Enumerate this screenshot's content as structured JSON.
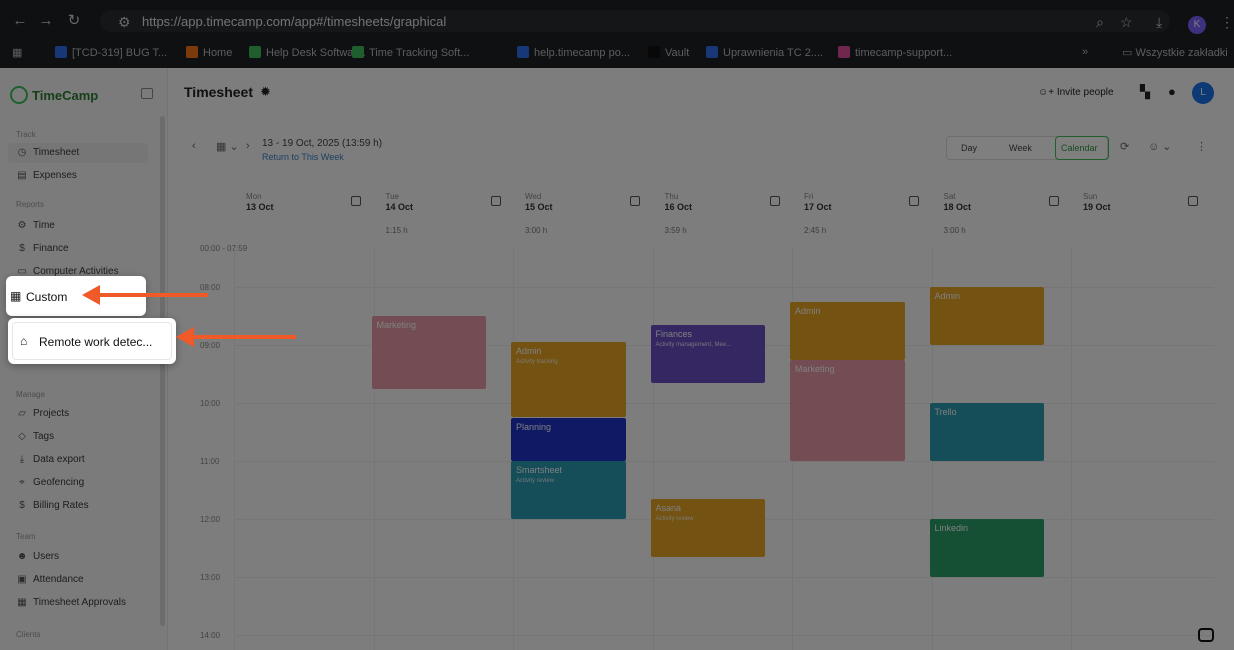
{
  "browser": {
    "url": "https://app.timecamp.com/app#/timesheets/graphical",
    "profile_initial": "K",
    "bookmarks": [
      {
        "label": "[TCD-319] BUG T...",
        "color": "#2f6fed"
      },
      {
        "label": "Home",
        "color": "#f97316"
      },
      {
        "label": "Help Desk Softwar...",
        "color": "#3fbf5a"
      },
      {
        "label": "Time Tracking Soft...",
        "color": "#3fbf5a"
      },
      {
        "label": "help.timecamp po...",
        "color": "#2f6fed"
      },
      {
        "label": "Vault",
        "color": "#111111"
      },
      {
        "label": "Uprawnienia TC 2....",
        "color": "#2f6fed"
      },
      {
        "label": "timecamp-support...",
        "color": "#e04e9a"
      }
    ],
    "more_label": "»",
    "all_bookmarks": "Wszystkie zakładki"
  },
  "app": {
    "logo": "TimeCamp",
    "page_title": "Timesheet",
    "invite_label": "Invite people",
    "avatar_initial": "L"
  },
  "sidebar": {
    "track_label": "Track",
    "reports_label": "Reports",
    "manage_label": "Manage",
    "team_label": "Team",
    "clients_label": "Clients",
    "items": {
      "timesheet": "Timesheet",
      "expenses": "Expenses",
      "time": "Time",
      "finance": "Finance",
      "computer_activities": "Computer Activities",
      "projects": "Projects",
      "tags": "Tags",
      "data_export": "Data export",
      "geofencing": "Geofencing",
      "billing_rates": "Billing Rates",
      "users": "Users",
      "attendance": "Attendance",
      "timesheet_approvals": "Timesheet Approvals"
    }
  },
  "toolbar": {
    "range": "13 - 19 Oct, 2025 (13:59 h)",
    "return_link": "Return to This Week",
    "views": [
      "Day",
      "Week",
      "Calendar"
    ],
    "active_view": "Calendar"
  },
  "calendar": {
    "days": [
      {
        "name": "Mon",
        "date": "13 Oct",
        "total": ""
      },
      {
        "name": "Tue",
        "date": "14 Oct",
        "total": "1:15 h"
      },
      {
        "name": "Wed",
        "date": "15 Oct",
        "total": "3:00 h"
      },
      {
        "name": "Thu",
        "date": "16 Oct",
        "total": "3:59 h"
      },
      {
        "name": "Fri",
        "date": "17 Oct",
        "total": "2:45 h"
      },
      {
        "name": "Sat",
        "date": "18 Oct",
        "total": "3:00 h"
      },
      {
        "name": "Sun",
        "date": "19 Oct",
        "total": ""
      }
    ],
    "allday_label": "00:00 - 07:59",
    "hours": [
      "08:00",
      "09:00",
      "10:00",
      "11:00",
      "12:00",
      "13:00",
      "14:00"
    ],
    "events": [
      {
        "day": 1,
        "start": 8.5,
        "end": 9.75,
        "title": "Marketing",
        "sub": "",
        "color": "#e89aa8"
      },
      {
        "day": 2,
        "start": 8.95,
        "end": 10.25,
        "title": "Admin",
        "sub": "Activity tracking",
        "color": "#e6a425"
      },
      {
        "day": 2,
        "start": 10.25,
        "end": 11.0,
        "title": "Planning",
        "sub": "",
        "color": "#1e33c8"
      },
      {
        "day": 2,
        "start": 11.0,
        "end": 12.0,
        "title": "Smartsheet",
        "sub": "Activity review",
        "color": "#2a9ab0"
      },
      {
        "day": 3,
        "start": 8.65,
        "end": 9.65,
        "title": "Finances",
        "sub": "Activity management, Mee...",
        "color": "#6a4fc4"
      },
      {
        "day": 3,
        "start": 11.65,
        "end": 12.65,
        "title": "Asana",
        "sub": "Activity review",
        "color": "#e6a425"
      },
      {
        "day": 4,
        "start": 8.25,
        "end": 9.25,
        "title": "Admin",
        "sub": "",
        "color": "#e6a425"
      },
      {
        "day": 4,
        "start": 9.25,
        "end": 11.0,
        "title": "Marketing",
        "sub": "",
        "color": "#e89aa8"
      },
      {
        "day": 5,
        "start": 8.0,
        "end": 9.0,
        "title": "Admin",
        "sub": "",
        "color": "#e6a425"
      },
      {
        "day": 5,
        "start": 10.0,
        "end": 11.0,
        "title": "Trello",
        "sub": "",
        "color": "#2a9ab0"
      },
      {
        "day": 5,
        "start": 12.0,
        "end": 13.0,
        "title": "Linkedin",
        "sub": "",
        "color": "#2aa06b"
      }
    ]
  },
  "popups": {
    "custom_label": "Custom",
    "remote_label": "Remote work detec..."
  },
  "colors": {
    "accent": "#3fbf5a",
    "arrow": "#f05a28"
  }
}
